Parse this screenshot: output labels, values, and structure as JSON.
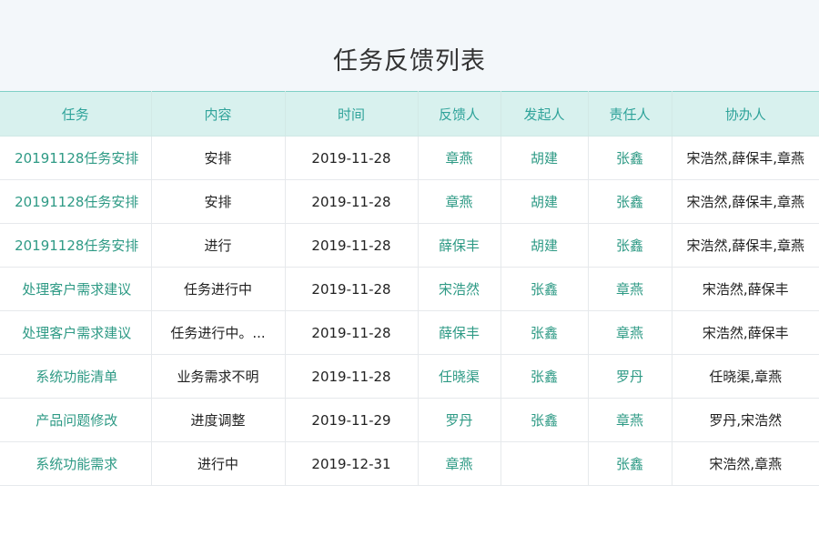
{
  "page": {
    "title": "任务反馈列表"
  },
  "colors": {
    "header_bg": "#d8f1ee",
    "header_text": "#2fa39a",
    "link_text": "#2e9a85",
    "body_text": "#222222"
  },
  "table": {
    "columns": [
      "任务",
      "内容",
      "时间",
      "反馈人",
      "发起人",
      "责任人",
      "协办人"
    ],
    "rows": [
      {
        "task": "20191128任务安排",
        "content": "安排",
        "time": "2019-11-28",
        "feedback": "章燕",
        "initiator": "胡建",
        "owner": "张鑫",
        "assist": "宋浩然,薛保丰,章燕"
      },
      {
        "task": "20191128任务安排",
        "content": "安排",
        "time": "2019-11-28",
        "feedback": "章燕",
        "initiator": "胡建",
        "owner": "张鑫",
        "assist": "宋浩然,薛保丰,章燕"
      },
      {
        "task": "20191128任务安排",
        "content": "进行",
        "time": "2019-11-28",
        "feedback": "薛保丰",
        "initiator": "胡建",
        "owner": "张鑫",
        "assist": "宋浩然,薛保丰,章燕"
      },
      {
        "task": "处理客户需求建议",
        "content": "任务进行中",
        "time": "2019-11-28",
        "feedback": "宋浩然",
        "initiator": "张鑫",
        "owner": "章燕",
        "assist": "宋浩然,薛保丰"
      },
      {
        "task": "处理客户需求建议",
        "content": "任务进行中。...",
        "time": "2019-11-28",
        "feedback": "薛保丰",
        "initiator": "张鑫",
        "owner": "章燕",
        "assist": "宋浩然,薛保丰"
      },
      {
        "task": "系统功能清单",
        "content": "业务需求不明",
        "time": "2019-11-28",
        "feedback": "任晓渠",
        "initiator": "张鑫",
        "owner": "罗丹",
        "assist": "任晓渠,章燕"
      },
      {
        "task": "产品问题修改",
        "content": "进度调整",
        "time": "2019-11-29",
        "feedback": "罗丹",
        "initiator": "张鑫",
        "owner": "章燕",
        "assist": "罗丹,宋浩然"
      },
      {
        "task": "系统功能需求",
        "content": "进行中",
        "time": "2019-12-31",
        "feedback": "章燕",
        "initiator": "",
        "owner": "张鑫",
        "assist": "宋浩然,章燕"
      }
    ]
  }
}
